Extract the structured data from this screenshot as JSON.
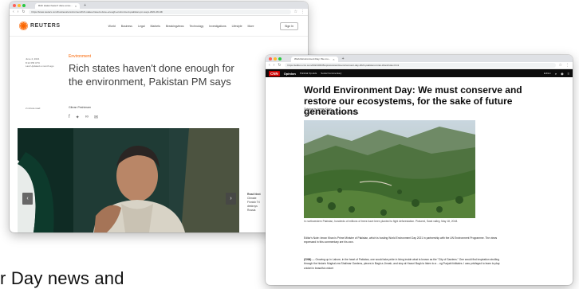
{
  "caption_fragment": "r Day news and",
  "colors": {
    "reuters_orange": "#fa6400",
    "cnn_red": "#cc0000",
    "cnn_nav": "#0c0c0c"
  },
  "reuters_window": {
    "tab_title": "Rich states haven't done enou...",
    "url": "https://www.reuters.com/business/environment/rich-states-havent-done-enough-environment-pakistan-pm-says-2021-06-04/",
    "brand": "REUTERS",
    "nav": [
      "World",
      "Business",
      "Legal",
      "Markets",
      "Breakingviews",
      "Technology",
      "Investigations",
      "Lifestyle",
      "More"
    ],
    "sign_in": "Sign In",
    "meta": [
      "June 4, 2021",
      "8:12 PM UTC",
      "Last Updated a month ago"
    ],
    "category": "Environment",
    "headline": "Rich states haven't done enough for the environment, Pakistan PM says",
    "byline_label": "2 minute read",
    "byline": "Gibran Peshimam",
    "sidebar": [
      "Read Next",
      "Climate",
      "Finnish Tri",
      "destroys",
      "Russia"
    ]
  },
  "cnn_window": {
    "tab_title": "World Environment Day: We mu...",
    "url": "https://edition.cnn.com/2021/06/05/opinions/world-environment-day-2021-pakistan-imran-khan/index.html",
    "logo": "CNN",
    "section": "Opinion",
    "nav": [
      "Political Op-Eds",
      "Social Commentary"
    ],
    "edition": "Edition",
    "title": "World Environment Day: We must conserve and restore our ecosystems, for the sake of future generations",
    "opinion_by": "Opinion by Imran Khan",
    "updated": "Updated 0719 GMT (1519 HKT) June 5, 2021",
    "photo_caption": "In northwestern Pakistan, hundreds of millions of trees have been planted to fight deforestation. Pictured, Swat valley, May 18, 2018.",
    "editors_note": "Editor's Note: Imran Khan is Prime Minister of Pakistan, which is hosting World Environment Day 2021 in partnership with the UN Environment Programme. The views expressed in this commentary are his own.",
    "para_lead": "(CNN)",
    "para_body": " — Growing up in Lahore, in the heart of Pakistan, one would take pride in living inside what is known as the \"City of Gardens.\" One would find inspiration strolling through the historic Mughal-era Shalimar Gardens, pieces in Bagh-e-Jinnah, and stop at Hazuri Bagh to listen to a ...ng Punjabi folktales. I was privileged to learn to play cricket in beautiful cricket"
  }
}
